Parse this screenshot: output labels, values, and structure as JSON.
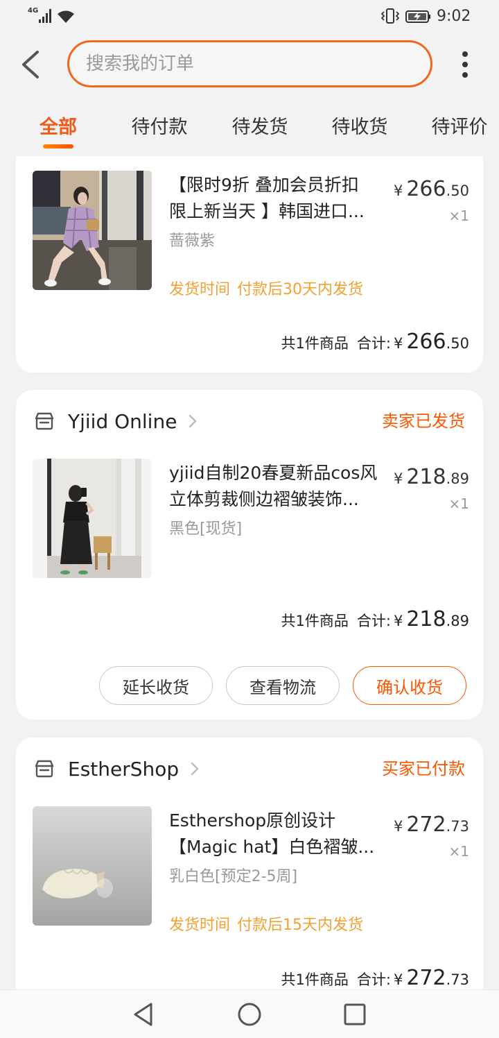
{
  "status_bar": {
    "network": "4G",
    "time": "9:02",
    "icons": [
      "signal-icon",
      "wifi-icon",
      "vibrate-icon",
      "battery-charging-icon"
    ]
  },
  "header": {
    "back_icon": "back-arrow-icon",
    "search": {
      "placeholder": "搜索我的订单"
    },
    "more_icon": "more-vertical-icon"
  },
  "tabs": [
    {
      "label": "全部",
      "active": true
    },
    {
      "label": "待付款",
      "active": false
    },
    {
      "label": "待发货",
      "active": false
    },
    {
      "label": "待收货",
      "active": false
    },
    {
      "label": "待评价",
      "active": false
    }
  ],
  "orders": [
    {
      "item": {
        "title_lines": [
          "【限时9折 叠加会员折扣",
          "限上新当天 】韩国进口..."
        ],
        "variant": "蔷薇紫",
        "delivery_label": "发货时间",
        "delivery_value": "付款后30天内发货",
        "price": {
          "currency": "¥",
          "integer": "266",
          "decimal": ".50"
        },
        "quantity": "×1"
      },
      "summary": {
        "count": "共1件商品",
        "total_label": "合计:",
        "currency": "¥",
        "integer": "266",
        "decimal": ".50"
      }
    },
    {
      "store": {
        "name": "Yjiid Online",
        "icon": "store-icon"
      },
      "status": "卖家已发货",
      "item": {
        "title_lines": [
          "yjiid自制20春夏新品cos风",
          "立体剪裁侧边褶皱装饰..."
        ],
        "variant": "黑色[现货]",
        "price": {
          "currency": "¥",
          "integer": "218",
          "decimal": ".89"
        },
        "quantity": "×1"
      },
      "summary": {
        "count": "共1件商品",
        "total_label": "合计:",
        "currency": "¥",
        "integer": "218",
        "decimal": ".89"
      },
      "actions": [
        {
          "label": "延长收货",
          "primary": false
        },
        {
          "label": "查看物流",
          "primary": false
        },
        {
          "label": "确认收货",
          "primary": true
        }
      ]
    },
    {
      "store": {
        "name": "EstherShop",
        "icon": "store-icon"
      },
      "status": "买家已付款",
      "item": {
        "title_lines": [
          "Esthershop原创设计",
          "【Magic hat】白色褶皱..."
        ],
        "variant": "乳白色[预定2-5周]",
        "delivery_label": "发货时间",
        "delivery_value": "付款后15天内发货",
        "price": {
          "currency": "¥",
          "integer": "272",
          "decimal": ".73"
        },
        "quantity": "×1"
      },
      "summary": {
        "count": "共1件商品",
        "total_label": "合计:",
        "currency": "¥",
        "integer": "272",
        "decimal": ".73"
      }
    }
  ],
  "system_nav": {
    "icons": [
      "nav-back-icon",
      "nav-home-icon",
      "nav-recents-icon"
    ]
  },
  "theme": {
    "accent": "#ff5500",
    "delivery_text": "#f3a032",
    "page_background": "#f2f2f2",
    "card_background": "#ffffff"
  }
}
